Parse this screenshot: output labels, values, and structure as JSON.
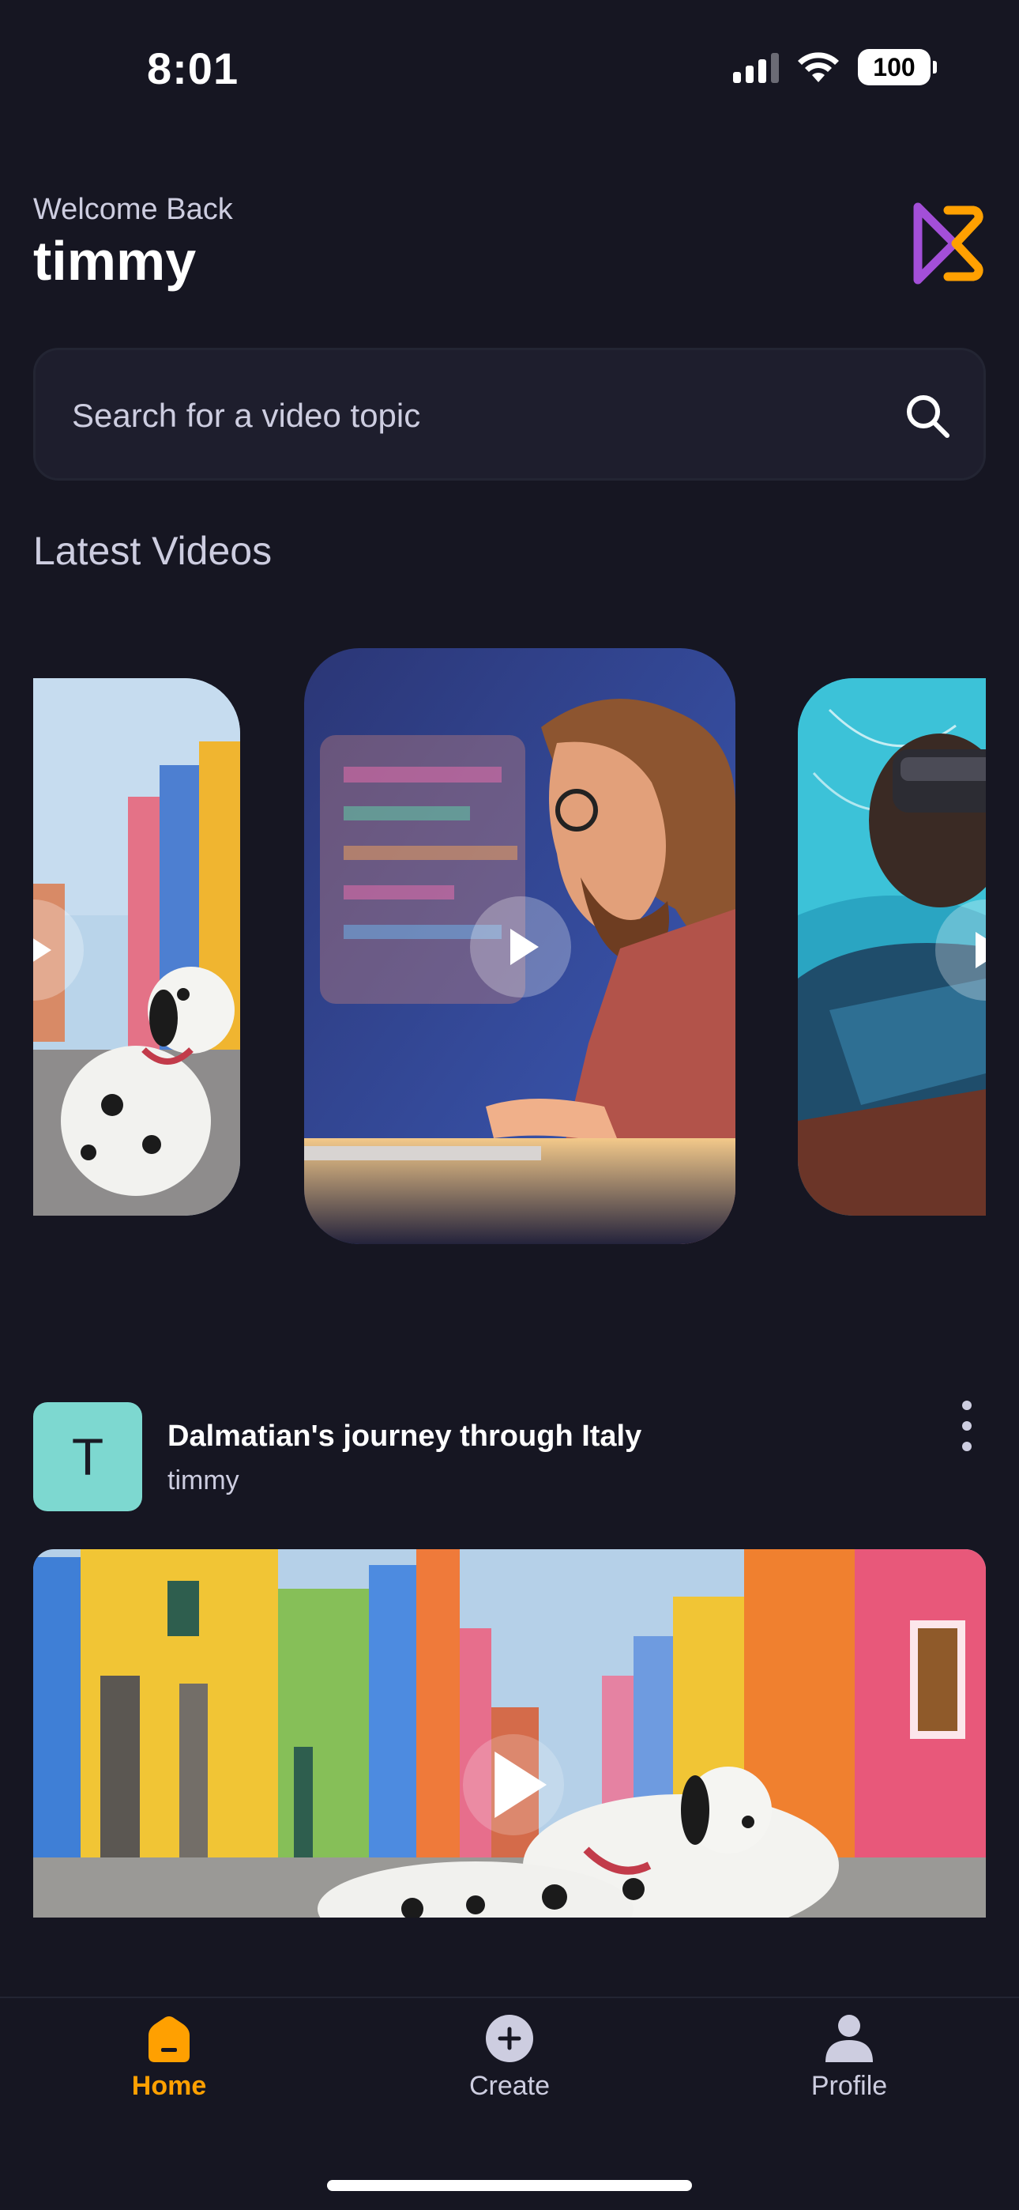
{
  "status_bar": {
    "time": "8:01",
    "battery": "100",
    "signal_icon": "signal-icon",
    "wifi_icon": "wifi-icon"
  },
  "header": {
    "welcome": "Welcome Back",
    "username": "timmy",
    "logo_icon": "app-logo-icon"
  },
  "search": {
    "placeholder": "Search for a video topic",
    "icon": "search-icon"
  },
  "latest": {
    "title": "Latest Videos",
    "cards": [
      {
        "subject": "dalmatian-in-italy",
        "position": "left"
      },
      {
        "subject": "bearded-man-coding",
        "position": "center"
      },
      {
        "subject": "man-with-vr-headset",
        "position": "right"
      }
    ]
  },
  "post": {
    "avatar_letter": "T",
    "title": "Dalmatian's journey through Italy",
    "author": "timmy",
    "menu_icon": "more-vertical-icon"
  },
  "tabs": [
    {
      "label": "Home",
      "icon": "home-icon",
      "active": true
    },
    {
      "label": "Create",
      "icon": "plus-circle-icon",
      "active": false
    },
    {
      "label": "Profile",
      "icon": "profile-icon",
      "active": false
    }
  ],
  "colors": {
    "background": "#161622",
    "accent": "#ffa001",
    "field": "#1e1e2d",
    "muted_text": "#cdcde0",
    "avatar": "#7dd8d0"
  }
}
